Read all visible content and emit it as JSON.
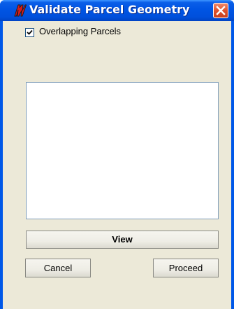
{
  "window": {
    "title": "Validate Parcel Geometry",
    "app_icon": "arcgis-icon",
    "close_icon": "close-icon"
  },
  "options": {
    "overlapping_parcels": {
      "label": "Overlapping Parcels",
      "checked": true
    }
  },
  "results_list": {
    "items": []
  },
  "buttons": {
    "view": "View",
    "cancel": "Cancel",
    "proceed": "Proceed"
  },
  "colors": {
    "titlebar": "#0054e3",
    "dialog_background": "#ece9d8",
    "close_button": "#e0522c",
    "app_icon_red": "#d41b1b"
  }
}
